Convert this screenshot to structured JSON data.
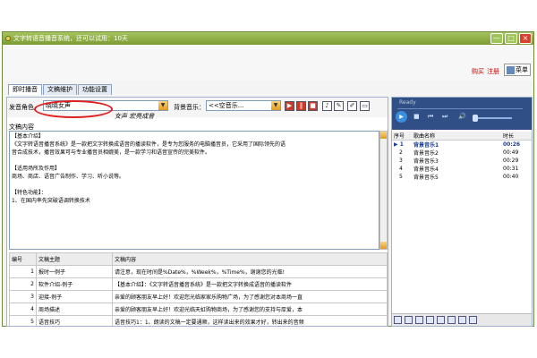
{
  "window": {
    "title": "文字转语音播音系统，还可以试用：10天",
    "controls": [
      "—",
      "□",
      "×"
    ]
  },
  "topbar": {
    "buy_label": "购买",
    "register_label": "注册",
    "menu_label": "菜单"
  },
  "tabs": [
    "即时播音",
    "文稿维护",
    "功能设置"
  ],
  "controls": {
    "voice_label": "发音角色",
    "voice_value": "晓晓女声",
    "bgm_label": "背景音乐：",
    "bgm_value": "<<空音乐...",
    "handwriting": "女声  宏亮成音"
  },
  "content": {
    "label": "文稿内容",
    "lines": [
      "【基本介绍】",
      "《文字转语音播音系统》是一款把文字转换成语音的播读软件，是专为您服务的电脑播音员，它采用了国际领先的语",
      "音合成技术，播音效果可与专业播音员相媲美，是一款学习和语音宣传的完美软件。",
      "",
      "【适用场所及作用】",
      "    商场、商店、语音广告制作、学习、听小说等。",
      "",
      "【特色功能】：",
      "  1、在国内率先突破语调转换技术"
    ]
  },
  "grid": {
    "headers": [
      "编号",
      "文稿主题",
      "文稿内容"
    ],
    "rows": [
      [
        "1",
        "报时一例子",
        "请注意，现在时间是%Date%，%Week%，%Time%，谢谢您的光临!"
      ],
      [
        "2",
        "软件介绍-例子",
        "【基本介绍】：《文字转语音播音系统》是一款把文字转换成语音的播读软件"
      ],
      [
        "3",
        "迎接-例子",
        "亲爱的顾客朋友早上好！欢迎您光临家家乐购物广场，为了感谢您对本商场一直"
      ],
      [
        "4",
        "周场描述",
        "亲爱的顾客朋友早上好！欢迎光临天虹购物商场，为了感谢您的支持与厚爱，本"
      ],
      [
        "5",
        "语音技巧",
        "语音技巧1：1、朗读的文稿一定要通顺，这样读出来的效果才好，转出来的音频"
      ]
    ]
  },
  "player": {
    "status": "Ready",
    "buttons": [
      "▶",
      "■",
      "⏮",
      "⏭",
      "🔊"
    ]
  },
  "playlist": {
    "headers": [
      "序号",
      "歌曲名称",
      "时长"
    ],
    "rows": [
      [
        "1",
        "背景音乐1",
        "00:26"
      ],
      [
        "2",
        "背景音乐2",
        "00:49"
      ],
      [
        "3",
        "背景音乐3",
        "00:29"
      ],
      [
        "4",
        "背景音乐4",
        "00:31"
      ],
      [
        "5",
        "背景音乐5",
        "00:40"
      ]
    ],
    "current_marker": "▶"
  }
}
